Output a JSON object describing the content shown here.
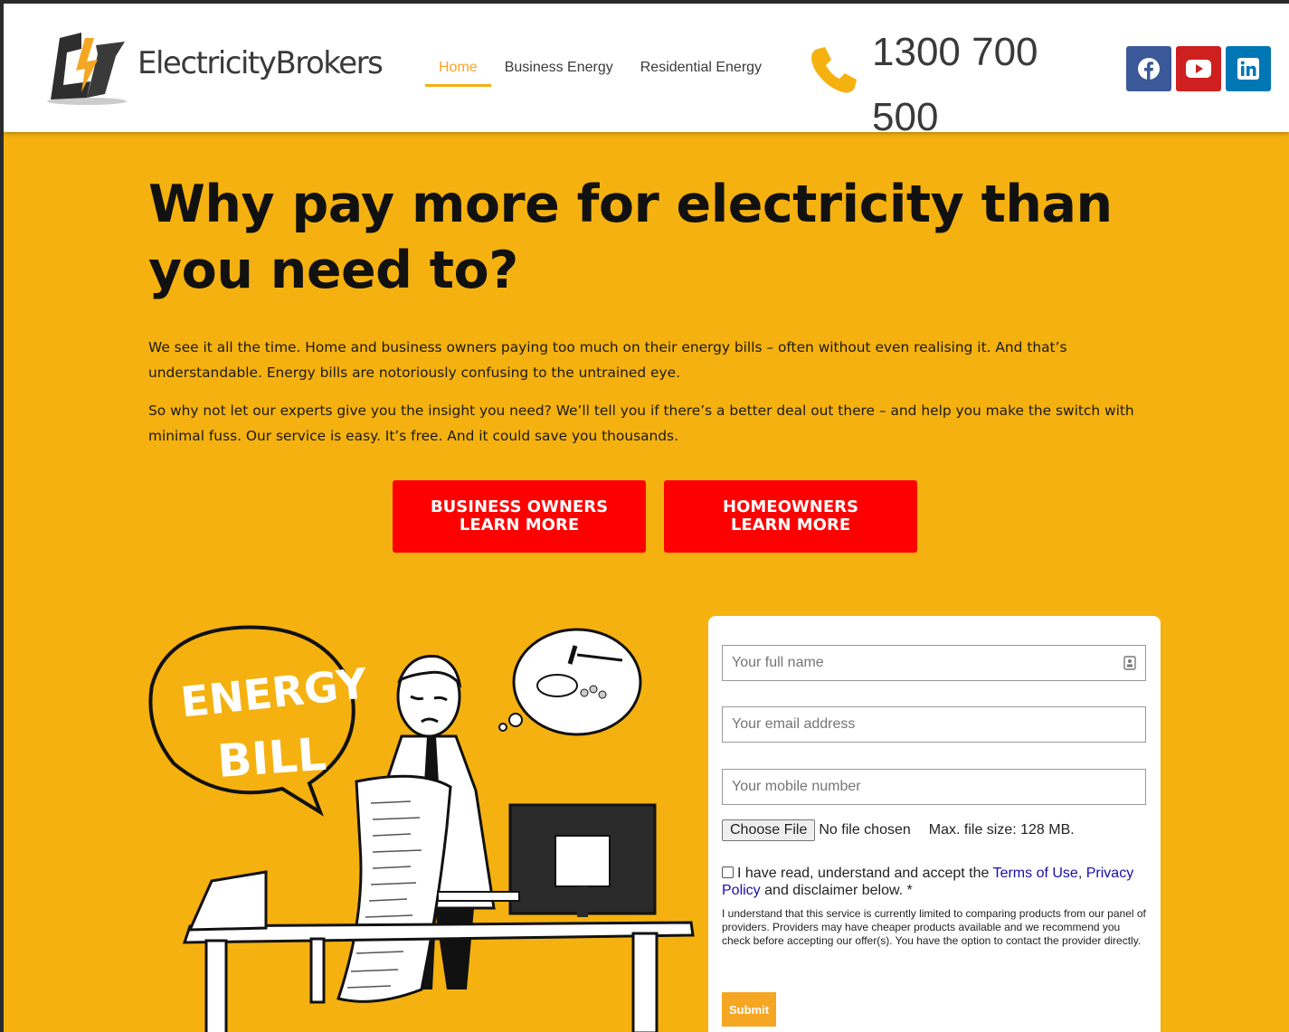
{
  "brand": {
    "name": "ElectricityBrokers"
  },
  "nav": {
    "items": [
      {
        "label": "Home",
        "active": true
      },
      {
        "label": "Business Energy",
        "active": false
      },
      {
        "label": "Residential Energy",
        "active": false
      }
    ]
  },
  "contact": {
    "phone": "1300 700 500",
    "phone_icon": "phone-icon"
  },
  "socials": [
    {
      "name": "facebook-icon",
      "color": "#3b5998"
    },
    {
      "name": "youtube-icon",
      "color": "#cd201f"
    },
    {
      "name": "linkedin-icon",
      "color": "#0077b5"
    }
  ],
  "hero": {
    "title": "Why pay more for electricity than you need to?",
    "paragraph_1": "We see it all the time. Home and business owners paying too much on their energy bills – often without even realising it. And that’s understandable. Energy bills are notoriously confusing to the untrained eye.",
    "paragraph_2": "So why not let our experts give you the insight you need? We’ll tell you if there’s a better deal out there – and help you make the switch with minimal fuss. Our service is easy. It’s free. And it could save you thousands."
  },
  "cta": {
    "business": {
      "line1": "BUSINESS OWNERS",
      "line2": "LEARN MORE"
    },
    "home": {
      "line1": "HOMEOWNERS",
      "line2": "LEARN MORE"
    }
  },
  "illustration": {
    "bubble_line1": "ENERGY",
    "bubble_line2": "BILL"
  },
  "form": {
    "name_placeholder": "Your full name",
    "email_placeholder": "Your email address",
    "mobile_placeholder": "Your mobile number",
    "file_button": "Choose File",
    "file_status": "No file chosen",
    "file_max": "Max. file size: 128 MB.",
    "consent_prefix": "I have read, understand and accept the",
    "terms_link": "Terms of Use",
    "comma": ",",
    "privacy_link": "Privacy Policy",
    "consent_suffix": "and disclaimer below. *",
    "disclaimer": "I understand that this service is currently limited to comparing products from our panel of providers. Providers may have cheaper products available and we recommend you check before accepting our offer(s). You have the option to contact the provider directly.",
    "submit_label": "Submit"
  },
  "colors": {
    "page_bg": "#f5b10f",
    "cta_red": "#ff0000",
    "accent_orange": "#f5a623",
    "link_blue": "#1a0dab"
  }
}
